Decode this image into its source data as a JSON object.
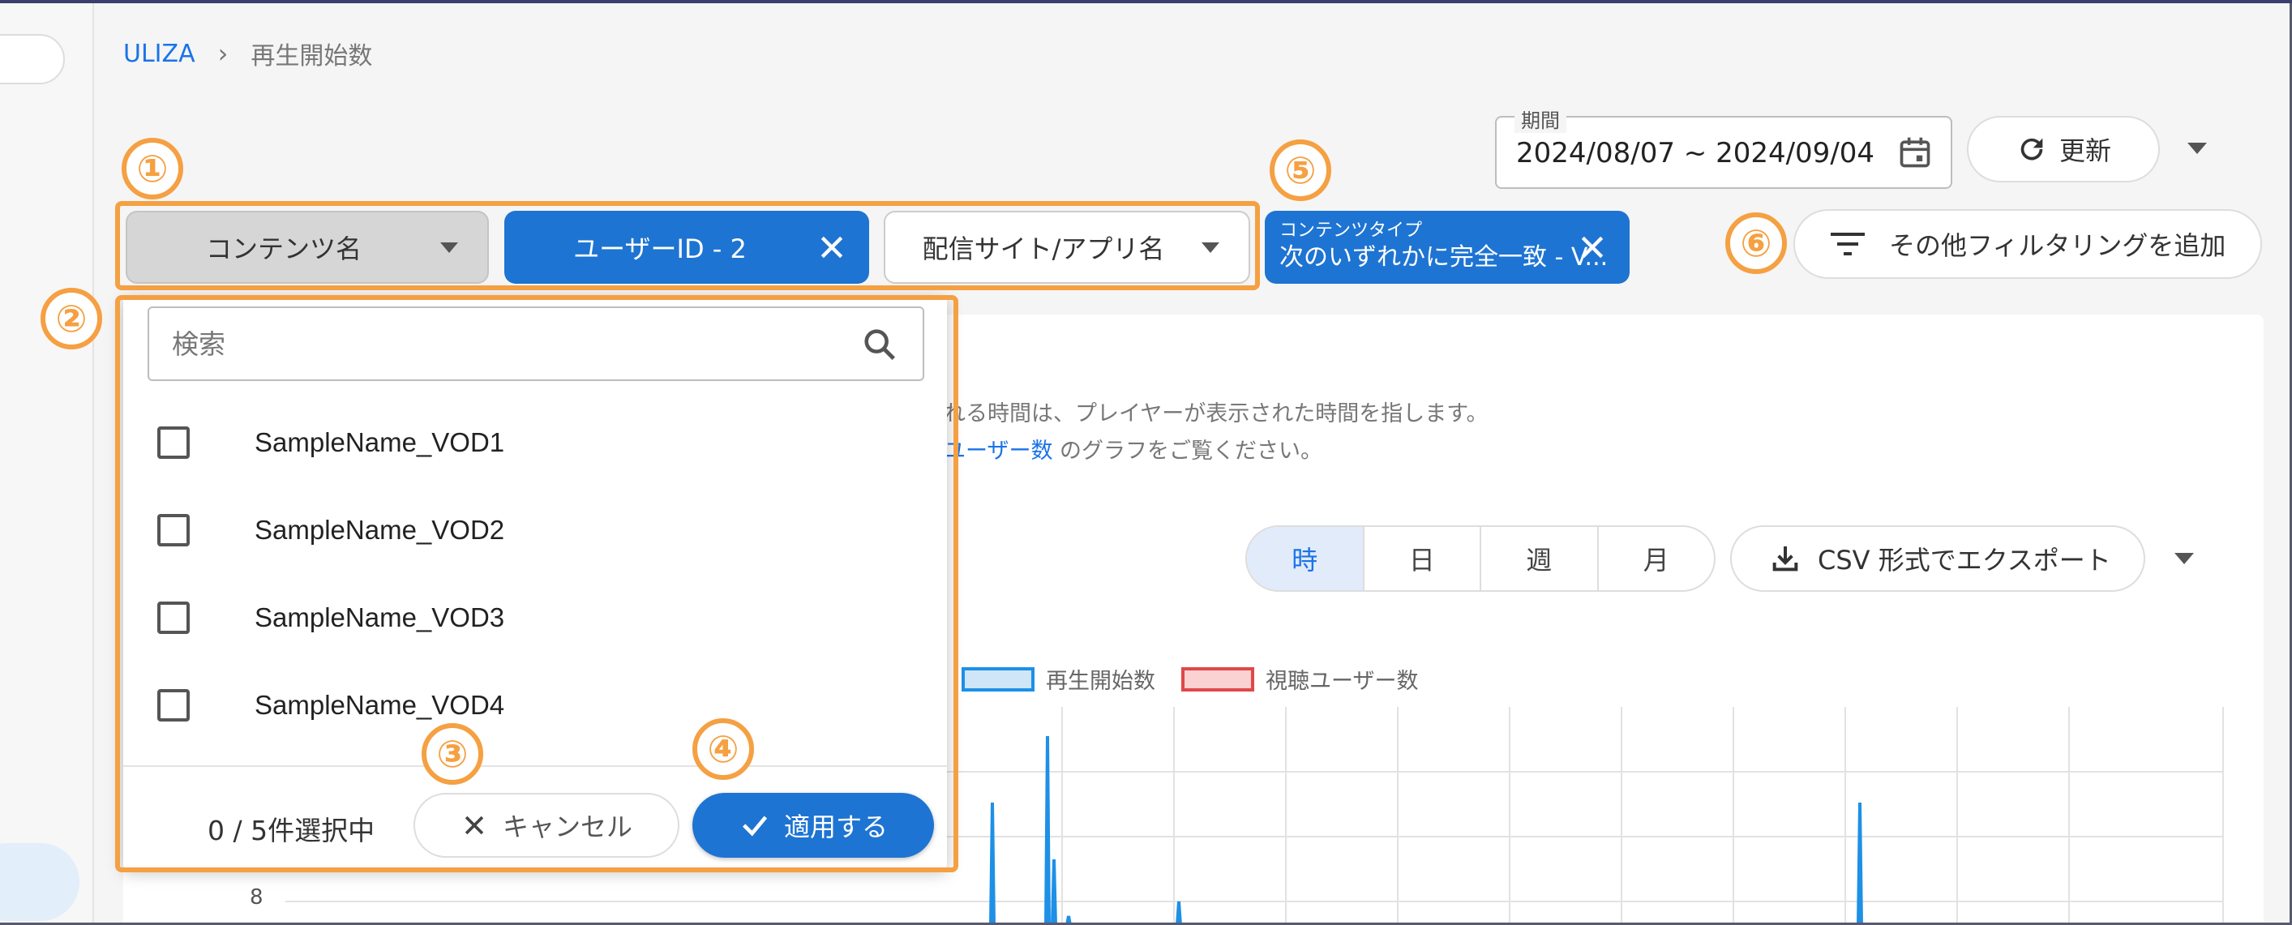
{
  "breadcrumb": {
    "root": "ULIZA",
    "separator": "›",
    "current": "再生開始数"
  },
  "period": {
    "label": "期間",
    "value": "2024/08/07 ~ 2024/09/04"
  },
  "refresh_label": "更新",
  "filters": {
    "content_name": "コンテンツ名",
    "user_id": "ユーザーID - 2",
    "site_app": "配信サイト/アプリ名",
    "content_type_small": "コンテンツタイプ",
    "content_type_main": "次のいずれかに完全一致 - V...",
    "add_filter": "その他フィルタリングを追加"
  },
  "annotations": [
    "①",
    "②",
    "③",
    "④",
    "⑤",
    "⑥"
  ],
  "description": {
    "line1": "れる時間は、プレイヤーが表示された時間を指します。",
    "line2_link": "ユーザー数",
    "line2_rest": " のグラフをご覧ください。"
  },
  "granularity": [
    "時",
    "日",
    "週",
    "月"
  ],
  "export_label": "CSV 形式でエクスポート",
  "legend": {
    "series1": "再生開始数",
    "series2": "視聴ユーザー数"
  },
  "y_tick": "8",
  "dropdown": {
    "search_placeholder": "検索",
    "options": [
      "SampleName_VOD1",
      "SampleName_VOD2",
      "SampleName_VOD3",
      "SampleName_VOD4"
    ],
    "selection_count": "0 / 5件選択中",
    "cancel": "キャンセル",
    "apply": "適用する"
  },
  "colors": {
    "primary": "#1e74d2",
    "annotation": "#f5a042",
    "series1": "#1e90e6",
    "series2": "#e04848"
  }
}
